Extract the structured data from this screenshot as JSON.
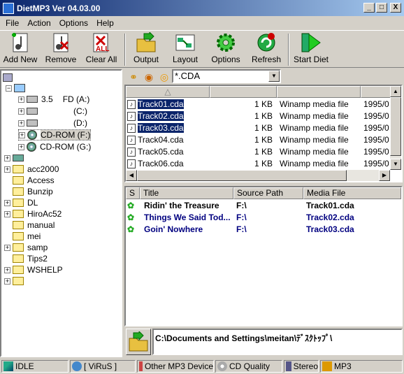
{
  "window": {
    "title": "DietMP3  Ver 04.03.00",
    "min_label": "_",
    "max_label": "□",
    "close_label": "X"
  },
  "menu": [
    "File",
    "Action",
    "Options",
    "Help"
  ],
  "toolbar": {
    "add_new": "Add New",
    "remove": "Remove",
    "clear_all": "Clear All",
    "output": "Output",
    "layout": "Layout",
    "options": "Options",
    "refresh": "Refresh",
    "start_diet": "Start Diet",
    "clear_all_badge": "ALL"
  },
  "tree": {
    "floppy_num": "3.5",
    "floppy": "FD (A:)",
    "c_drive": "(C:)",
    "d_drive": "(D:)",
    "f_drive": "CD-ROM (F:)",
    "g_drive": "CD-ROM (G:)",
    "folders": [
      "acc2000",
      "Access",
      "Bunzip",
      "DL",
      "HiroAc52",
      "manual",
      "mei",
      "samp",
      "Tips2",
      "WSHELP"
    ]
  },
  "filter": {
    "value": "*.CDA"
  },
  "files": {
    "sort_arrow": "△",
    "rows": [
      {
        "name": "Track01.cda",
        "size": "1 KB",
        "type": "Winamp media file",
        "date": "1995/0",
        "selected": true
      },
      {
        "name": "Track02.cda",
        "size": "1 KB",
        "type": "Winamp media file",
        "date": "1995/0",
        "selected": true
      },
      {
        "name": "Track03.cda",
        "size": "1 KB",
        "type": "Winamp media file",
        "date": "1995/0",
        "selected": true
      },
      {
        "name": "Track04.cda",
        "size": "1 KB",
        "type": "Winamp media file",
        "date": "1995/0",
        "selected": false
      },
      {
        "name": "Track05.cda",
        "size": "1 KB",
        "type": "Winamp media file",
        "date": "1995/0",
        "selected": false
      },
      {
        "name": "Track06.cda",
        "size": "1 KB",
        "type": "Winamp media file",
        "date": "1995/0",
        "selected": false
      }
    ]
  },
  "tracks": {
    "headers": {
      "s": "S",
      "title": "Title",
      "source": "Source Path",
      "media": "Media File"
    },
    "rows": [
      {
        "title": "Ridin' the Treasure",
        "source": "F:\\",
        "media": "Track01.cda",
        "color": "#000000"
      },
      {
        "title": "Things We Said Tod...",
        "source": "F:\\",
        "media": "Track02.cda",
        "color": "#000080"
      },
      {
        "title": "Goin' Nowhere",
        "source": "F:\\",
        "media": "Track03.cda",
        "color": "#000080"
      }
    ]
  },
  "output_path": "C:\\Documents and Settings\\meitan\\ﾃﾞｽｸﾄｯﾌﾟ\\",
  "status": {
    "state": "IDLE",
    "user": "[ ViRuS ]",
    "device": "Other MP3 Device",
    "quality": "CD Quality",
    "channel": "Stereo",
    "format": "MP3"
  }
}
